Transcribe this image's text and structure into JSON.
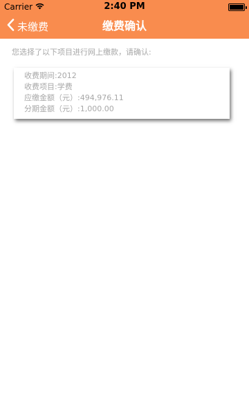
{
  "status_bar": {
    "carrier": "Carrier",
    "time": "2:40 PM"
  },
  "nav": {
    "back_label": "未缴费",
    "title": "缴费确认",
    "bg_color": "#f98c4e"
  },
  "intro_text": "您选择了以下项目进行网上缴款，请确认:",
  "card": {
    "rows": [
      {
        "label": "收费期间:",
        "value": "2012"
      },
      {
        "label": "收费项目:",
        "value": "学费"
      },
      {
        "label": "应缴金额（元）:",
        "value": "494,976.11"
      },
      {
        "label": "分期金额（元）:",
        "value": "1,000.00"
      }
    ]
  }
}
